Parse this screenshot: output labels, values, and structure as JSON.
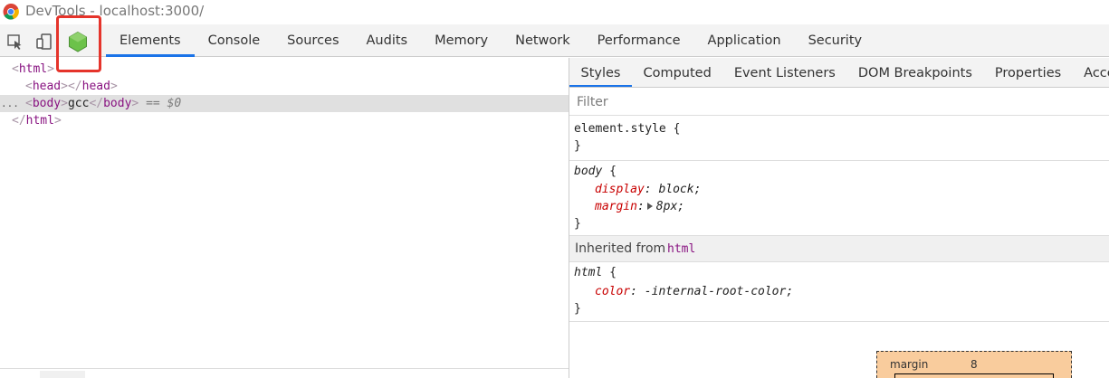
{
  "window": {
    "title": "DevTools - localhost:3000/"
  },
  "toolbar": {
    "icons": [
      "inspect-element-icon",
      "device-toolbar-icon",
      "nodejs-icon"
    ],
    "tabs": [
      {
        "label": "Elements",
        "active": true
      },
      {
        "label": "Console"
      },
      {
        "label": "Sources"
      },
      {
        "label": "Audits"
      },
      {
        "label": "Memory"
      },
      {
        "label": "Network"
      },
      {
        "label": "Performance"
      },
      {
        "label": "Application"
      },
      {
        "label": "Security"
      }
    ],
    "highlight_color": "#e5342b",
    "accent_color": "#1a73e8"
  },
  "dom": {
    "html_tag": "html",
    "head_tag": "head",
    "body_tag": "body",
    "body_text": "gcc",
    "selected_marker": "== $0",
    "dots": "..."
  },
  "styles": {
    "subtabs": [
      {
        "label": "Styles",
        "active": true
      },
      {
        "label": "Computed"
      },
      {
        "label": "Event Listeners"
      },
      {
        "label": "DOM Breakpoints"
      },
      {
        "label": "Properties"
      },
      {
        "label": "Accessibility"
      }
    ],
    "filter_placeholder": "Filter",
    "element_style": {
      "selector": "element.style {",
      "close": "}"
    },
    "body_rule": {
      "selector": "body",
      "open": "{",
      "props": [
        {
          "name": "display",
          "value": "block;"
        },
        {
          "name": "margin",
          "value": "8px;"
        }
      ],
      "close": "}"
    },
    "inherited": {
      "label": "Inherited from",
      "from": "html"
    },
    "html_rule": {
      "selector": "html",
      "open": "{",
      "props": [
        {
          "name": "color",
          "value": "-internal-root-color;"
        }
      ],
      "close": "}"
    },
    "box_model": {
      "margin_label": "margin",
      "margin_value": "8"
    }
  }
}
